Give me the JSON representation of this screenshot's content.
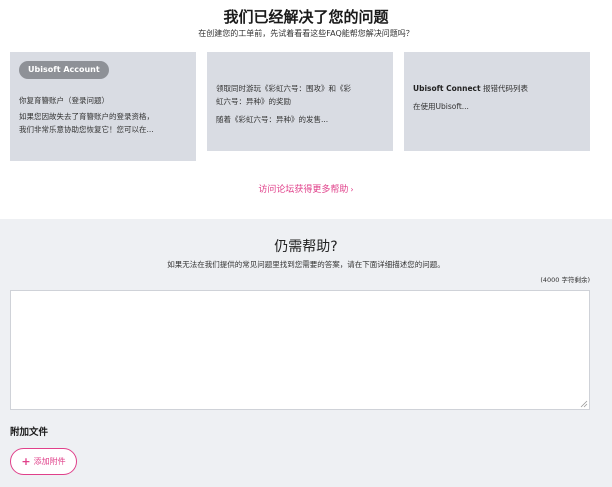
{
  "header": {
    "title": "我们已经解决了您的问题",
    "subtitle": "在创建您的工单前，先试着看看这些FAQ能帮您解决问题吗？"
  },
  "cards": [
    {
      "badge": "Ubisoft Account",
      "title": "你复育簪账户（登录问题）",
      "lines": [
        "如果您因故失去了育簪账户的登录资格，",
        "我们非常乐意协助您恢复它！您可以在..."
      ]
    },
    {
      "lines": [
        "领取同时游玩《彩虹六号：围攻》和《彩",
        "虹六号：异种》的奖励"
      ],
      "extra": "随着《彩虹六号：异种》的发售..."
    },
    {
      "title_strong": "Ubisoft Connect",
      "title_rest": " 报错代码列表",
      "extra": "在使用Ubisoft..."
    }
  ],
  "forum_link": {
    "label": "访问论坛获得更多帮助",
    "chevron": "›"
  },
  "help": {
    "title": "仍需帮助?",
    "subtitle": "如果无法在我们提供的常见问题里找到您需要的答案，请在下面详细描述您的问题。",
    "char_count": "(4000 字符剩余)",
    "textarea_value": ""
  },
  "attachments": {
    "label": "附加文件",
    "button_label": "添加附件",
    "button_icon": "+"
  },
  "colors": {
    "accent": "#e0408a",
    "card_bg": "#d9dce3",
    "section_bg": "#eef0f3"
  }
}
